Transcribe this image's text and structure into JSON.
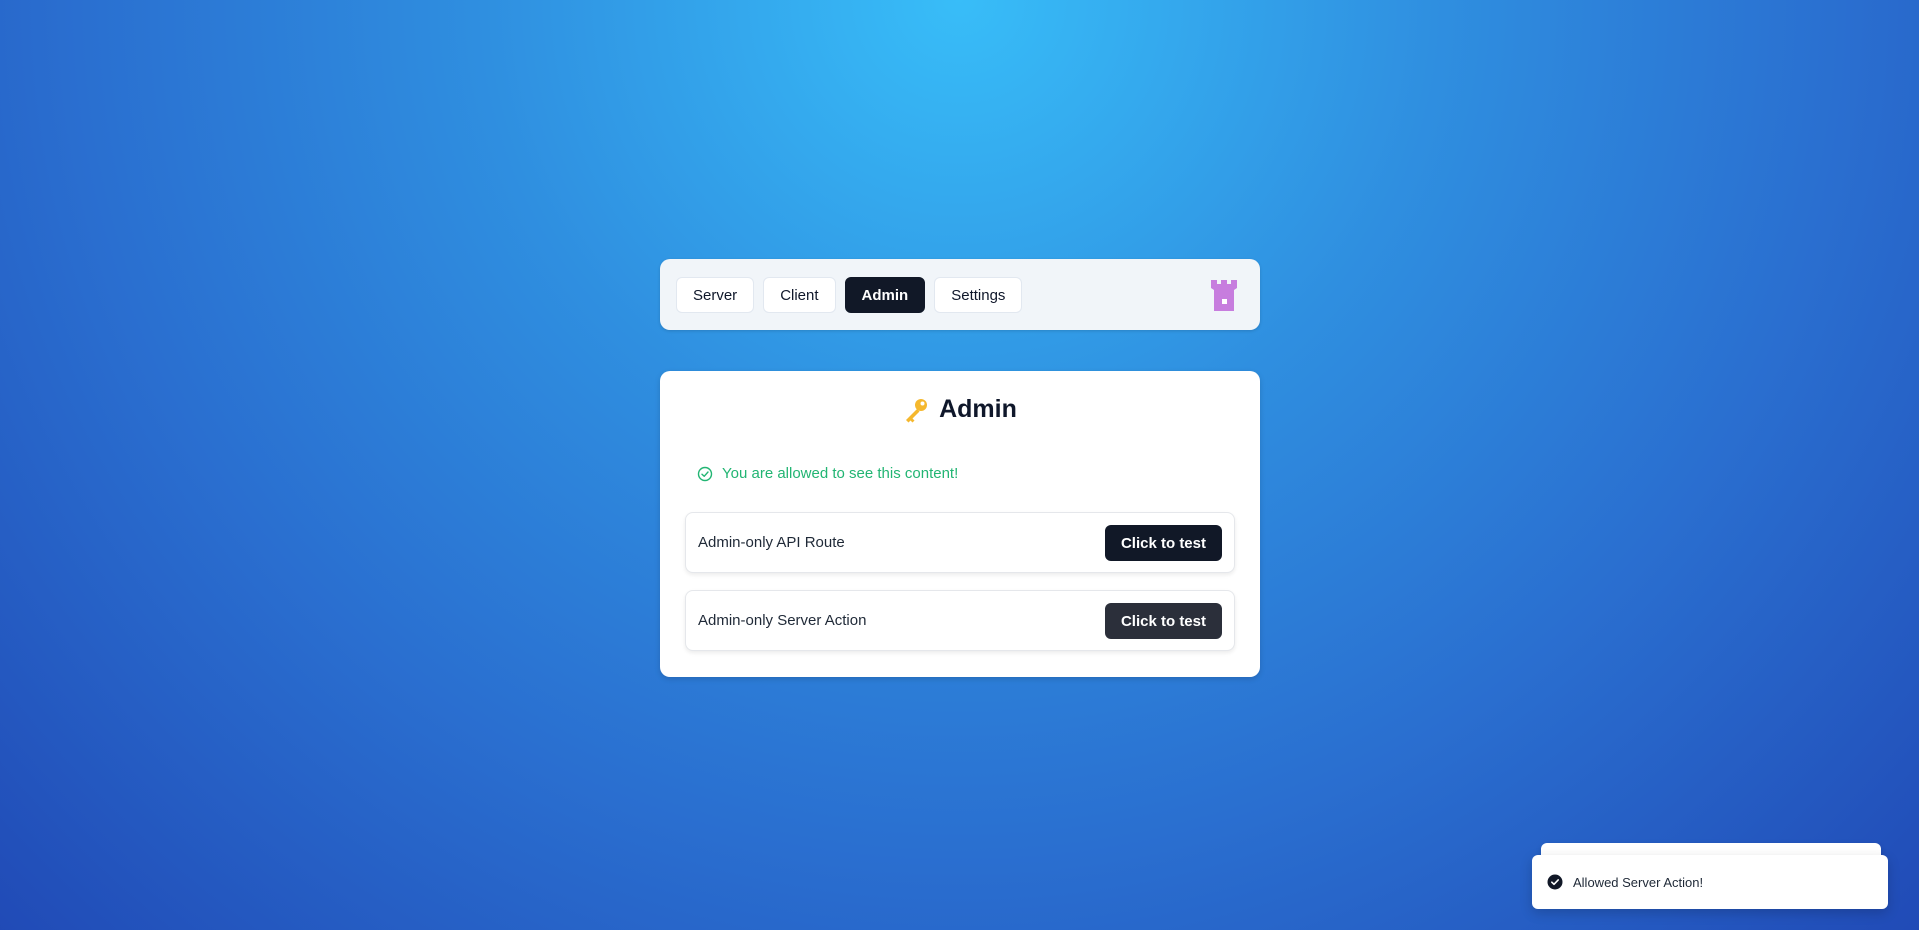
{
  "nav": {
    "tabs": [
      {
        "label": "Server",
        "active": false
      },
      {
        "label": "Client",
        "active": false
      },
      {
        "label": "Admin",
        "active": true
      },
      {
        "label": "Settings",
        "active": false
      }
    ],
    "logo_icon": "castle-tower-icon"
  },
  "card": {
    "title": "Admin",
    "title_icon": "key-icon",
    "notice": {
      "text": "You are allowed to see this content!",
      "icon": "check-circle-icon",
      "color": "#22b573"
    },
    "rows": [
      {
        "label": "Admin-only API Route",
        "button": "Click to test"
      },
      {
        "label": "Admin-only Server Action",
        "button": "Click to test"
      }
    ]
  },
  "toast": {
    "message": "Allowed Server Action!",
    "icon": "check-circle-filled-icon"
  },
  "colors": {
    "accent": "#111827",
    "success": "#22b573",
    "logo": "#c77dde",
    "key": "#f5b82e"
  }
}
